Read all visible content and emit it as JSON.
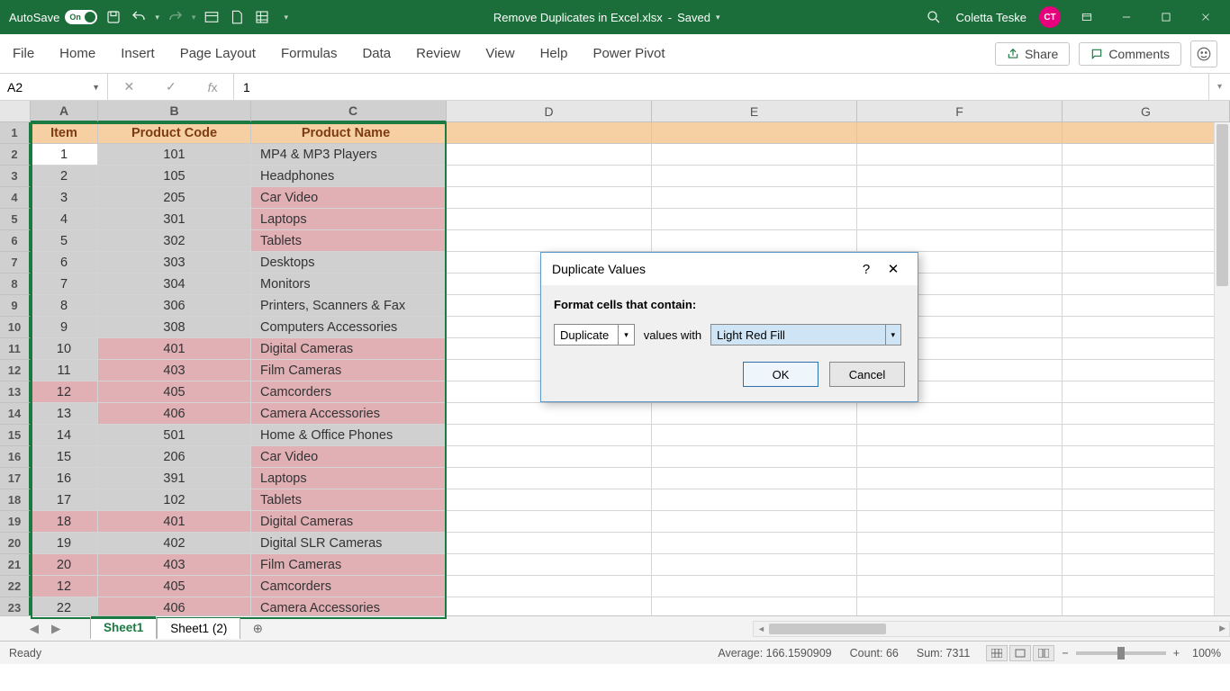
{
  "titlebar": {
    "autosave": "AutoSave",
    "toggle_state": "On",
    "filename": "Remove Duplicates in Excel.xlsx",
    "save_status": "Saved",
    "username": "Coletta Teske",
    "initials": "CT"
  },
  "ribbon": {
    "tabs": [
      "File",
      "Home",
      "Insert",
      "Page Layout",
      "Formulas",
      "Data",
      "Review",
      "View",
      "Help",
      "Power Pivot"
    ],
    "share": "Share",
    "comments": "Comments"
  },
  "formula": {
    "namebox": "A2",
    "value": "1"
  },
  "columns": [
    "A",
    "B",
    "C",
    "D",
    "E",
    "F",
    "G"
  ],
  "headers": {
    "A": "Item",
    "B": "Product Code",
    "C": "Product Name"
  },
  "rows": [
    {
      "n": 2,
      "a": "1",
      "b": "101",
      "c": "MP4 & MP3 Players",
      "da": false,
      "db": false,
      "dc": false,
      "active": true
    },
    {
      "n": 3,
      "a": "2",
      "b": "105",
      "c": "Headphones",
      "da": false,
      "db": false,
      "dc": false
    },
    {
      "n": 4,
      "a": "3",
      "b": "205",
      "c": "Car Video",
      "da": false,
      "db": false,
      "dc": true
    },
    {
      "n": 5,
      "a": "4",
      "b": "301",
      "c": "Laptops",
      "da": false,
      "db": false,
      "dc": true
    },
    {
      "n": 6,
      "a": "5",
      "b": "302",
      "c": "Tablets",
      "da": false,
      "db": false,
      "dc": true
    },
    {
      "n": 7,
      "a": "6",
      "b": "303",
      "c": "Desktops",
      "da": false,
      "db": false,
      "dc": false
    },
    {
      "n": 8,
      "a": "7",
      "b": "304",
      "c": "Monitors",
      "da": false,
      "db": false,
      "dc": false
    },
    {
      "n": 9,
      "a": "8",
      "b": "306",
      "c": "Printers, Scanners & Fax",
      "da": false,
      "db": false,
      "dc": false
    },
    {
      "n": 10,
      "a": "9",
      "b": "308",
      "c": "Computers Accessories",
      "da": false,
      "db": false,
      "dc": false
    },
    {
      "n": 11,
      "a": "10",
      "b": "401",
      "c": "Digital Cameras",
      "da": false,
      "db": true,
      "dc": true
    },
    {
      "n": 12,
      "a": "11",
      "b": "403",
      "c": "Film Cameras",
      "da": false,
      "db": true,
      "dc": true
    },
    {
      "n": 13,
      "a": "12",
      "b": "405",
      "c": "Camcorders",
      "da": true,
      "db": true,
      "dc": true
    },
    {
      "n": 14,
      "a": "13",
      "b": "406",
      "c": "Camera Accessories",
      "da": false,
      "db": true,
      "dc": true
    },
    {
      "n": 15,
      "a": "14",
      "b": "501",
      "c": "Home & Office Phones",
      "da": false,
      "db": false,
      "dc": false
    },
    {
      "n": 16,
      "a": "15",
      "b": "206",
      "c": "Car Video",
      "da": false,
      "db": false,
      "dc": true
    },
    {
      "n": 17,
      "a": "16",
      "b": "391",
      "c": "Laptops",
      "da": false,
      "db": false,
      "dc": true
    },
    {
      "n": 18,
      "a": "17",
      "b": "102",
      "c": "Tablets",
      "da": false,
      "db": false,
      "dc": true
    },
    {
      "n": 19,
      "a": "18",
      "b": "401",
      "c": "Digital Cameras",
      "da": true,
      "db": true,
      "dc": true
    },
    {
      "n": 20,
      "a": "19",
      "b": "402",
      "c": "Digital SLR Cameras",
      "da": false,
      "db": false,
      "dc": false
    },
    {
      "n": 21,
      "a": "20",
      "b": "403",
      "c": "Film Cameras",
      "da": true,
      "db": true,
      "dc": true
    },
    {
      "n": 22,
      "a": "12",
      "b": "405",
      "c": "Camcorders",
      "da": true,
      "db": true,
      "dc": true
    },
    {
      "n": 23,
      "a": "22",
      "b": "406",
      "c": "Camera Accessories",
      "da": false,
      "db": true,
      "dc": true
    }
  ],
  "sheets": {
    "active": "Sheet1",
    "other": "Sheet1 (2)"
  },
  "status": {
    "ready": "Ready",
    "average": "Average: 166.1590909",
    "count": "Count: 66",
    "sum": "Sum: 7311",
    "zoom": "100%"
  },
  "dialog": {
    "title": "Duplicate Values",
    "label": "Format cells that contain:",
    "type": "Duplicate",
    "mid": "values with",
    "format": "Light Red Fill",
    "ok": "OK",
    "cancel": "Cancel"
  }
}
